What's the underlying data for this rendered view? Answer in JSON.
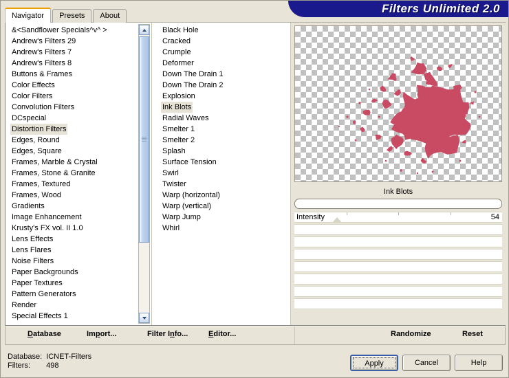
{
  "window": {
    "app_title": "Filters Unlimited 2.0",
    "accent_navy": "#1a1a8c",
    "accent_orange": "#f0a000",
    "face_color": "#e8e4d8",
    "ink_color": "#c94a63"
  },
  "tabs": [
    {
      "label": "Navigator",
      "active": true
    },
    {
      "label": "Presets",
      "active": false
    },
    {
      "label": "About",
      "active": false
    }
  ],
  "categories": {
    "selected": "Distortion Filters",
    "items": [
      "&<Sandflower Specials^v^ >",
      "Andrew's Filters 29",
      "Andrew's Filters 7",
      "Andrew's Filters 8",
      "Buttons & Frames",
      "Color Effects",
      "Color Filters",
      "Convolution Filters",
      "DCspecial",
      "Distortion Filters",
      "Edges, Round",
      "Edges, Square",
      "Frames, Marble & Crystal",
      "Frames, Stone & Granite",
      "Frames, Textured",
      "Frames, Wood",
      "Gradients",
      "Image Enhancement",
      "Krusty's FX vol. II 1.0",
      "Lens Effects",
      "Lens Flares",
      "Noise Filters",
      "Paper Backgrounds",
      "Paper Textures",
      "Pattern Generators",
      "Render",
      "Special Effects 1"
    ],
    "scrollbar": {
      "up_icon": "chevron-up-icon",
      "down_icon": "chevron-down-icon",
      "thumb_grip_icon": "grip-lines-icon"
    }
  },
  "filters": {
    "selected": "Ink Blots",
    "items": [
      "Black Hole",
      "Cracked",
      "Crumple",
      "Deformer",
      "Down The Drain 1",
      "Down The Drain 2",
      "Explosion",
      "Ink Blots",
      "Radial Waves",
      "Smelter 1",
      "Smelter 2",
      "Splash",
      "Surface Tension",
      "Swirl",
      "Twister",
      "Warp (horizontal)",
      "Warp (vertical)",
      "Warp Jump",
      "Whirl"
    ]
  },
  "preview": {
    "filter_name": "Ink Blots",
    "preset_value": "",
    "preset_placeholder": ""
  },
  "parameters": [
    {
      "label": "Intensity",
      "value": "54",
      "percent": 54,
      "has_slider": true
    },
    {
      "label": "",
      "value": "",
      "has_slider": false
    },
    {
      "label": "",
      "value": "",
      "has_slider": false
    },
    {
      "label": "",
      "value": "",
      "has_slider": false
    },
    {
      "label": "",
      "value": "",
      "has_slider": false
    },
    {
      "label": "",
      "value": "",
      "has_slider": false
    },
    {
      "label": "",
      "value": "",
      "has_slider": false
    },
    {
      "label": "",
      "value": "",
      "has_slider": false
    }
  ],
  "action_bar": {
    "left": [
      {
        "label": "Database",
        "mnemonic": "D"
      },
      {
        "label": "Import...",
        "mnemonic": "p"
      },
      {
        "label": "Filter Info...",
        "mnemonic": "n"
      },
      {
        "label": "Editor...",
        "mnemonic": "E"
      }
    ],
    "right": [
      {
        "label": "Randomize"
      },
      {
        "label": "Reset"
      }
    ]
  },
  "status": {
    "database_label": "Database:",
    "database_value": "ICNET-Filters",
    "filters_label": "Filters:",
    "filters_value": "498"
  },
  "dialog_buttons": [
    {
      "label": "Apply",
      "focused": true
    },
    {
      "label": "Cancel",
      "focused": false
    },
    {
      "label": "Help",
      "focused": false
    }
  ]
}
